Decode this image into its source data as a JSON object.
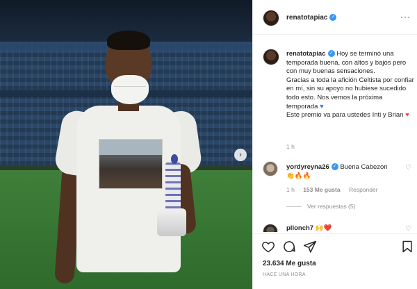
{
  "post": {
    "author": "renatotapiac",
    "caption": "Hoy se terminó una temporada buena, con altos y bajos pero con muy buenas sensaciones.\nGracias a toda la afición Celtista por confiar en mí, sin su apoyo no hubiese sucedido todo esto. Nos vemos la próxima temporada",
    "caption_line2": "Este premio va para ustedes Inti y Brian",
    "caption_time": "1 h",
    "likes": "23.634 Me gusta",
    "time_ago": "HACE UNA HORA"
  },
  "comments": [
    {
      "user": "yordyreyna26",
      "text": "Buena Cabezon",
      "emojis": "👏🔥🔥",
      "time": "1 h",
      "likes": "153 Me gusta",
      "reply_label": "Responder",
      "view_replies": "Ver respuestas (5)"
    },
    {
      "user": "pllonch7",
      "text": "🙌❤️"
    }
  ],
  "icons": {
    "verified": "verified-badge-icon",
    "more": "more-options-icon",
    "next": "chevron-right-icon",
    "like": "heart-outline-icon",
    "comment": "comment-icon",
    "share": "share-icon",
    "save": "bookmark-icon",
    "blue_heart": "blue-heart-icon",
    "red_heart": "red-heart-icon"
  },
  "colors": {
    "verified": "#3897f0",
    "muted": "#8e8e8e",
    "red_heart": "#ed4956",
    "blue_heart": "#3d7fd6"
  }
}
